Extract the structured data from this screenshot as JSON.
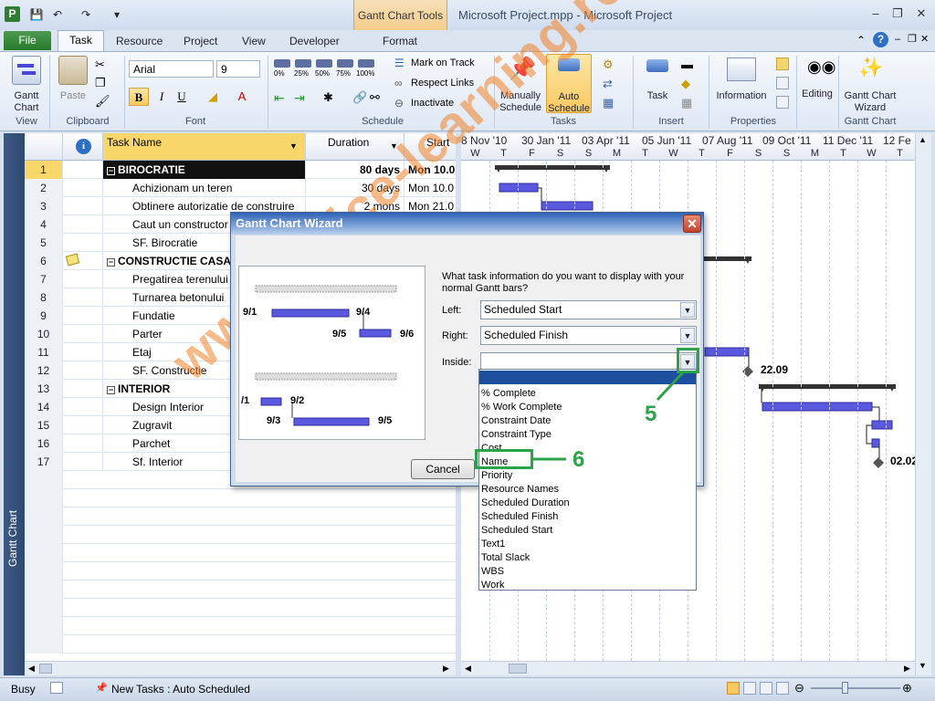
{
  "title_bar": {
    "app_title": "Microsoft Project.mpp  -  Microsoft Project",
    "context_tab": "Gantt Chart Tools"
  },
  "tabs": [
    "File",
    "Task",
    "Resource",
    "Project",
    "View",
    "Developer",
    "Format"
  ],
  "ribbon": {
    "groups": {
      "view": "View",
      "clipboard": "Clipboard",
      "font": "Font",
      "schedule": "Schedule",
      "tasks": "Tasks",
      "insert": "Insert",
      "properties": "Properties",
      "gantt_chart": "Gantt Chart"
    },
    "gantt_chart": "Gantt Chart",
    "paste": "Paste",
    "font_name": "Arial",
    "font_size": "9",
    "mark_on_track": "Mark on Track",
    "respect_links": "Respect Links",
    "inactivate": "Inactivate",
    "pct": [
      "0%",
      "25%",
      "50%",
      "75%",
      "100%"
    ],
    "manually": "Manually Schedule",
    "auto": "Auto Schedule",
    "task": "Task",
    "information": "Information",
    "editing": "Editing",
    "wizard": "Gantt Chart Wizard"
  },
  "sidebar_label": "Gantt Chart",
  "table": {
    "headers": {
      "task_name": "Task Name",
      "duration": "Duration",
      "start": "Start"
    },
    "rows": [
      {
        "id": "1",
        "name": "BIROCRATIE",
        "duration": "80 days",
        "start": "Mon 10.0",
        "summary": true
      },
      {
        "id": "2",
        "name": "Achizionam un teren",
        "duration": "30 days",
        "start": "Mon 10.0"
      },
      {
        "id": "3",
        "name": "Obtinere autorizatie de construire",
        "duration": "2 mons",
        "start": "Mon 21.0"
      },
      {
        "id": "4",
        "name": "Caut un constructor",
        "duration": "",
        "start": ""
      },
      {
        "id": "5",
        "name": "SF. Birocratie",
        "duration": "",
        "start": ""
      },
      {
        "id": "6",
        "name": "CONSTRUCTIE CASA",
        "duration": "",
        "start": "",
        "summary": true
      },
      {
        "id": "7",
        "name": "Pregatirea terenului",
        "duration": "",
        "start": ""
      },
      {
        "id": "8",
        "name": "Turnarea betonului",
        "duration": "",
        "start": ""
      },
      {
        "id": "9",
        "name": "Fundatie",
        "duration": "",
        "start": ""
      },
      {
        "id": "10",
        "name": "Parter",
        "duration": "",
        "start": ""
      },
      {
        "id": "11",
        "name": "Etaj",
        "duration": "",
        "start": ""
      },
      {
        "id": "12",
        "name": "SF. Constructie",
        "duration": "",
        "start": ""
      },
      {
        "id": "13",
        "name": "INTERIOR",
        "duration": "",
        "start": "",
        "summary": true
      },
      {
        "id": "14",
        "name": "Design Interior",
        "duration": "",
        "start": ""
      },
      {
        "id": "15",
        "name": "Zugravit",
        "duration": "",
        "start": ""
      },
      {
        "id": "16",
        "name": "Parchet",
        "duration": "",
        "start": ""
      },
      {
        "id": "17",
        "name": "Sf. Interior",
        "duration": "",
        "start": ""
      }
    ]
  },
  "timescale": {
    "top": [
      "8 Nov '10",
      "30 Jan '11",
      "03 Apr '11",
      "05 Jun '11",
      "07 Aug '11",
      "09 Oct '11",
      "11 Dec '11",
      "12 Fe"
    ],
    "bottom": [
      "W",
      "T",
      "F",
      "S",
      "S",
      "M",
      "T",
      "W",
      "T",
      "F",
      "S",
      "S",
      "M",
      "T",
      "W",
      "T"
    ]
  },
  "chart_labels": {
    "milestone1": "22.09",
    "milestone2": "02.02"
  },
  "dialog": {
    "title": "Gantt Chart Wizard",
    "question": "What task information do you want to display with your normal Gantt bars?",
    "left_label": "Left:",
    "left_value": "Scheduled Start",
    "right_label": "Right:",
    "right_value": "Scheduled Finish",
    "inside_label": "Inside:",
    "inside_value": "",
    "cancel": "Cancel",
    "preview_labels": {
      "a": "9/1",
      "b": "9/4",
      "c": "9/5",
      "d": "9/6",
      "e": "/1",
      "f": "9/2",
      "g": "9/3",
      "h": "9/5"
    }
  },
  "dropdown_options": [
    "",
    "% Complete",
    "% Work Complete",
    "Constraint Date",
    "Constraint Type",
    "Cost",
    "Name",
    "Priority",
    "Resource Names",
    "Scheduled Duration",
    "Scheduled Finish",
    "Scheduled Start",
    "Text1",
    "Total Slack",
    "WBS",
    "Work"
  ],
  "annotations": {
    "step5": "5",
    "step6": "6"
  },
  "watermark": "www.office-learning.ro",
  "status": {
    "mode": "Busy",
    "new_tasks": "New Tasks : Auto Scheduled"
  },
  "colors": {
    "accent": "#2ca24a",
    "bar": "#4a47d6",
    "selected_header": "#f8d66a",
    "watermark": "#f08228"
  }
}
